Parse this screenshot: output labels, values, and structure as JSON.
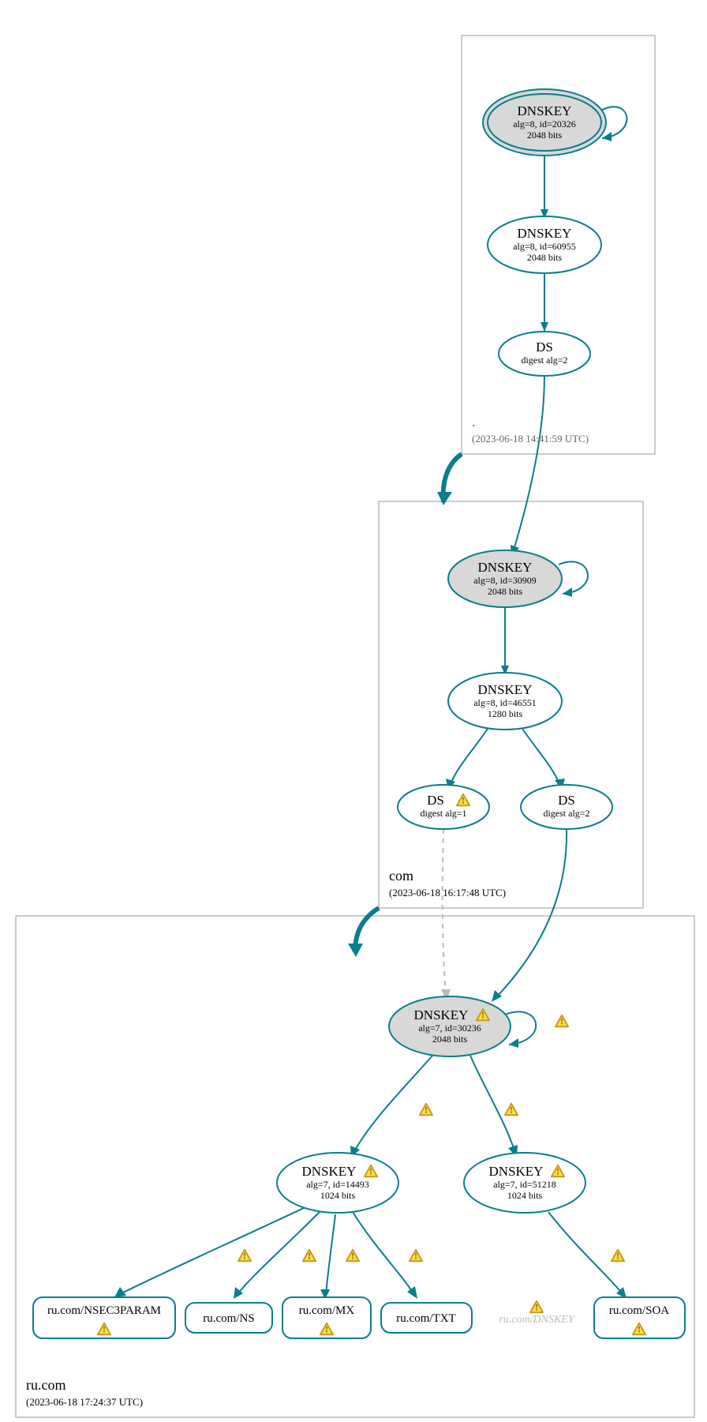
{
  "zones": {
    "root": {
      "label": ".",
      "timestamp": "(2023-06-18 14:41:59 UTC)"
    },
    "com": {
      "label": "com",
      "timestamp": "(2023-06-18 16:17:48 UTC)"
    },
    "rucom": {
      "label": "ru.com",
      "timestamp": "(2023-06-18 17:24:37 UTC)"
    }
  },
  "nodes": {
    "root_ksk": {
      "title": "DNSKEY",
      "l2": "alg=8, id=20326",
      "l3": "2048 bits"
    },
    "root_zsk": {
      "title": "DNSKEY",
      "l2": "alg=8, id=60955",
      "l3": "2048 bits"
    },
    "root_ds": {
      "title": "DS",
      "l2": "digest alg=2"
    },
    "com_ksk": {
      "title": "DNSKEY",
      "l2": "alg=8, id=30909",
      "l3": "2048 bits"
    },
    "com_zsk": {
      "title": "DNSKEY",
      "l2": "alg=8, id=46551",
      "l3": "1280 bits"
    },
    "com_ds1": {
      "title": "DS",
      "l2": "digest alg=1"
    },
    "com_ds2": {
      "title": "DS",
      "l2": "digest alg=2"
    },
    "ru_ksk": {
      "title": "DNSKEY",
      "l2": "alg=7, id=30236",
      "l3": "2048 bits"
    },
    "ru_zsk_a": {
      "title": "DNSKEY",
      "l2": "alg=7, id=14493",
      "l3": "1024 bits"
    },
    "ru_zsk_b": {
      "title": "DNSKEY",
      "l2": "alg=7, id=51218",
      "l3": "1024 bits"
    },
    "rr_nsec3": {
      "label": "ru.com/NSEC3PARAM"
    },
    "rr_ns": {
      "label": "ru.com/NS"
    },
    "rr_mx": {
      "label": "ru.com/MX"
    },
    "rr_txt": {
      "label": "ru.com/TXT"
    },
    "rr_dnskey": {
      "label": "ru.com/DNSKEY"
    },
    "rr_soa": {
      "label": "ru.com/SOA"
    }
  }
}
